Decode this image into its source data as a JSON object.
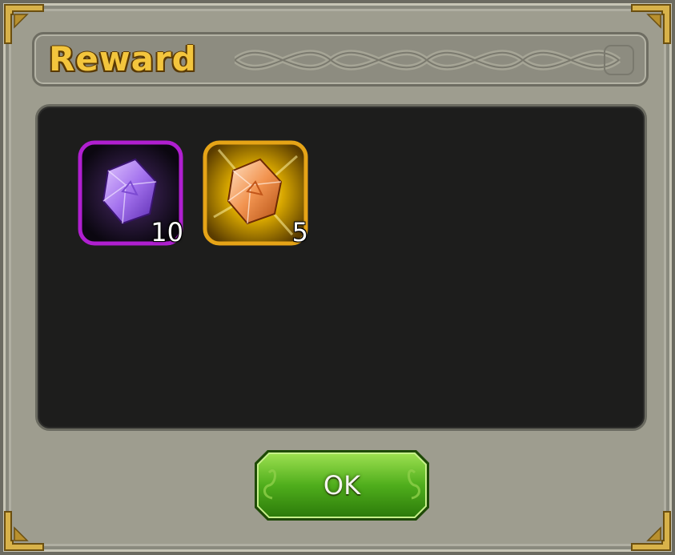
{
  "dialog": {
    "title": "Reward",
    "ok_label": "OK"
  },
  "rewards": [
    {
      "icon": "purple-gem-icon",
      "frame_color": "#b01fd0",
      "count": "10"
    },
    {
      "icon": "orange-gem-icon",
      "frame_color": "#e6a417",
      "count": "5"
    }
  ],
  "colors": {
    "title": "#f3c53d",
    "frame": "#9e9d8f",
    "panel": "#1d1d1c",
    "ok_button": "#4fae1c"
  }
}
